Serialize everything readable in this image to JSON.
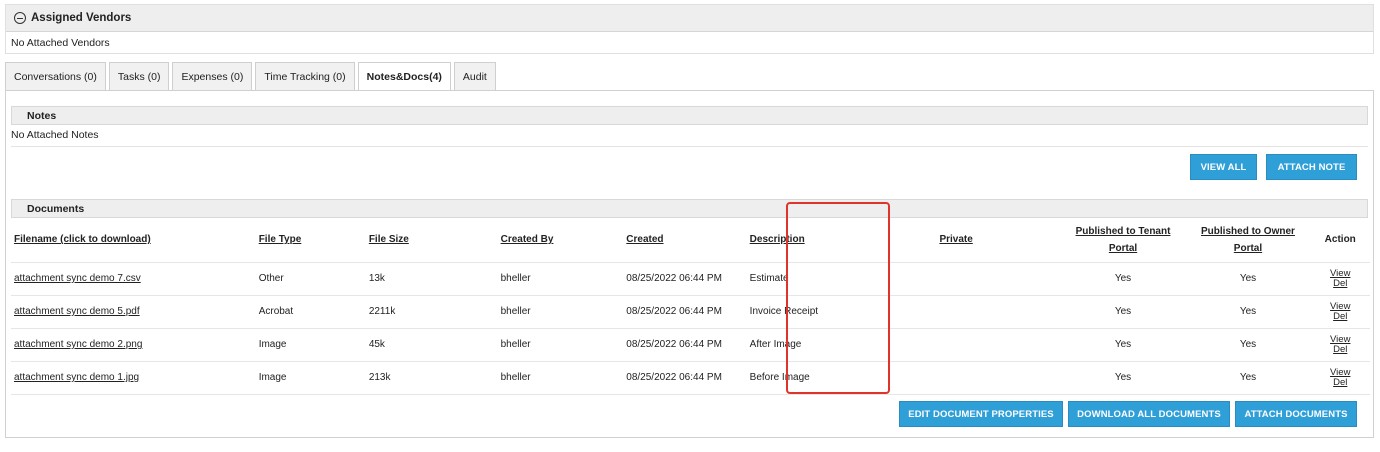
{
  "vendors": {
    "title": "Assigned Vendors",
    "empty_text": "No Attached Vendors"
  },
  "tabs": [
    {
      "label": "Conversations (0)"
    },
    {
      "label": "Tasks (0)"
    },
    {
      "label": "Expenses (0)"
    },
    {
      "label": "Time Tracking (0)"
    },
    {
      "label": "Notes&Docs(4)",
      "active": true
    },
    {
      "label": "Audit"
    }
  ],
  "notes": {
    "title": "Notes",
    "empty_text": "No Attached Notes",
    "view_all_label": "VIEW ALL",
    "attach_note_label": "ATTACH NOTE"
  },
  "documents": {
    "title": "Documents",
    "columns": {
      "filename": "Filename (click to download)",
      "file_type": "File Type",
      "file_size": "File Size",
      "created_by": "Created By",
      "created": "Created",
      "description": "Description",
      "private": "Private",
      "published_tenant_line1": "Published to Tenant",
      "published_tenant_line2": "Portal",
      "published_owner_line1": "Published to Owner",
      "published_owner_line2": "Portal",
      "action": "Action"
    },
    "rows": [
      {
        "filename": "attachment sync demo 7.csv",
        "file_type": "Other",
        "file_size": "13k",
        "created_by": "bheller",
        "created": "08/25/2022 06:44 PM",
        "description": "Estimate",
        "private": "",
        "tenant": "Yes",
        "owner": "Yes",
        "view": "View",
        "del": "Del"
      },
      {
        "filename": "attachment sync demo 5.pdf",
        "file_type": "Acrobat",
        "file_size": "2211k",
        "created_by": "bheller",
        "created": "08/25/2022 06:44 PM",
        "description": "Invoice Receipt",
        "private": "",
        "tenant": "Yes",
        "owner": "Yes",
        "view": "View",
        "del": "Del"
      },
      {
        "filename": "attachment sync demo 2.png",
        "file_type": "Image",
        "file_size": "45k",
        "created_by": "bheller",
        "created": "08/25/2022 06:44 PM",
        "description": "After Image",
        "private": "",
        "tenant": "Yes",
        "owner": "Yes",
        "view": "View",
        "del": "Del"
      },
      {
        "filename": "attachment sync demo 1.jpg",
        "file_type": "Image",
        "file_size": "213k",
        "created_by": "bheller",
        "created": "08/25/2022 06:44 PM",
        "description": "Before Image",
        "private": "",
        "tenant": "Yes",
        "owner": "Yes",
        "view": "View",
        "del": "Del"
      }
    ],
    "edit_properties_label": "EDIT DOCUMENT PROPERTIES",
    "download_all_label": "DOWNLOAD ALL DOCUMENTS",
    "attach_documents_label": "ATTACH DOCUMENTS"
  },
  "colors": {
    "button_blue": "#2f9fd8",
    "highlight_red": "#e0332c",
    "header_gray": "#eeeeee"
  }
}
